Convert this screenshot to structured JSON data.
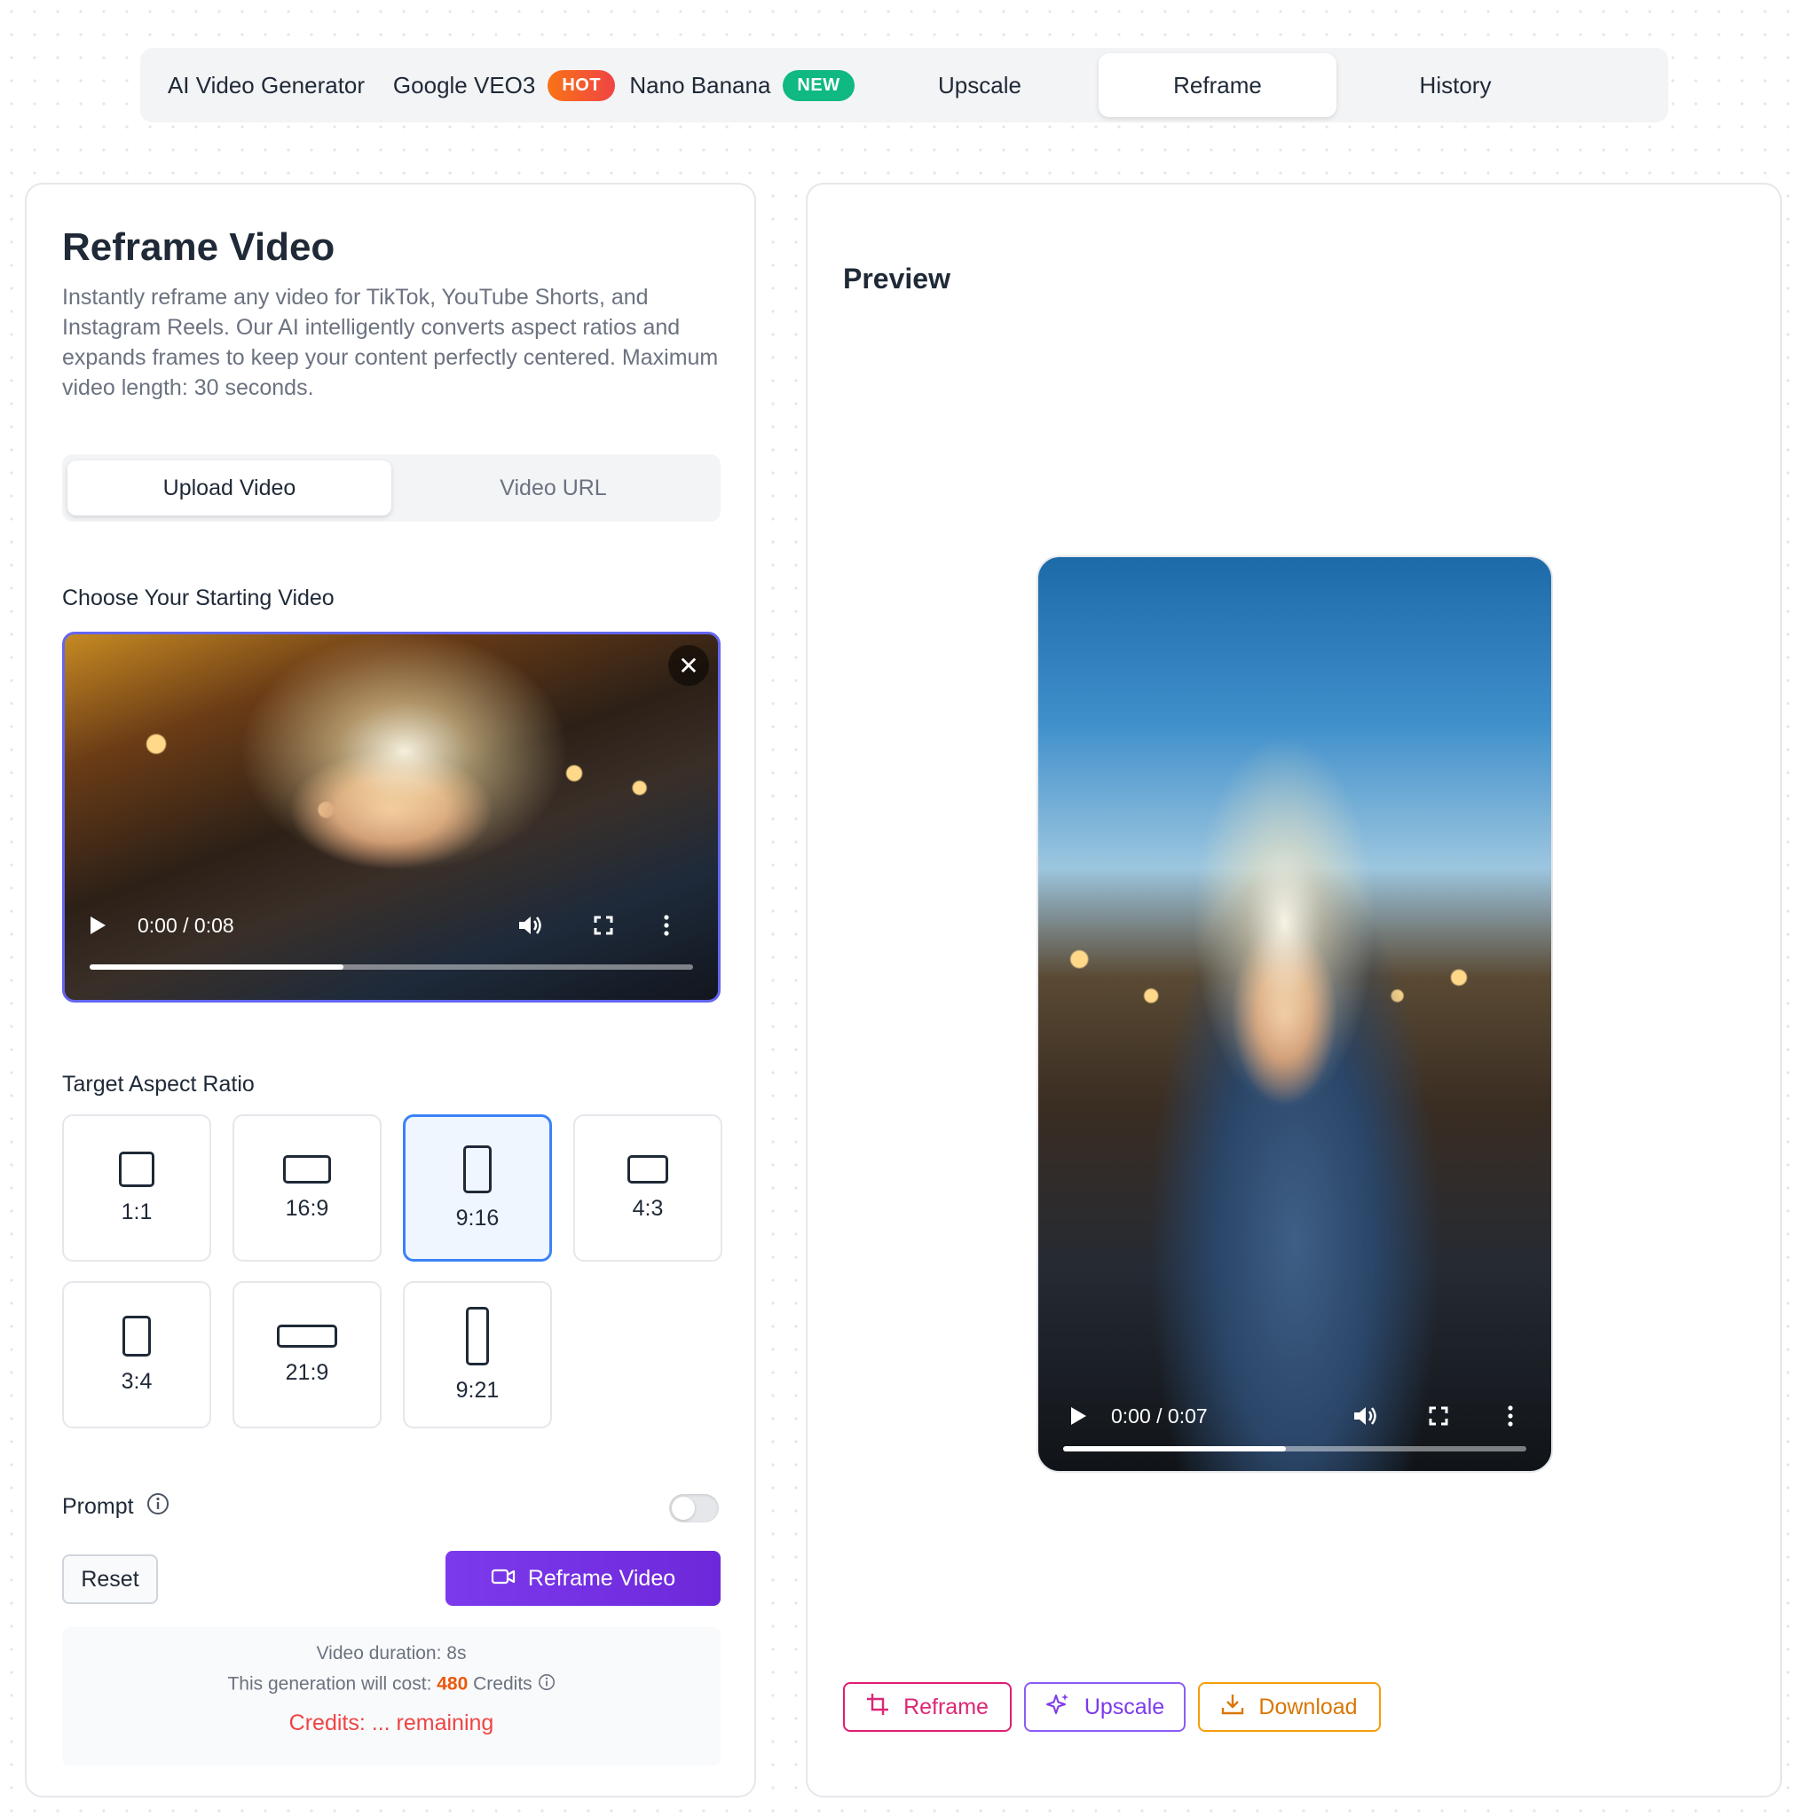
{
  "topnav": {
    "tabs": [
      {
        "label": "AI Video Generator"
      },
      {
        "label": "Google VEO3",
        "badge": "HOT"
      },
      {
        "label": "Nano Banana",
        "badge": "NEW"
      },
      {
        "label": "Upscale"
      },
      {
        "label": "Reframe",
        "active": true
      },
      {
        "label": "History"
      }
    ]
  },
  "left": {
    "title": "Reframe Video",
    "description": "Instantly reframe any video for TikTok, YouTube Shorts, and Instagram Reels. Our AI intelligently converts aspect ratios and expands frames to keep your content perfectly centered. Maximum video length: 30 seconds.",
    "source_tabs": [
      {
        "label": "Upload Video",
        "active": true
      },
      {
        "label": "Video URL"
      }
    ],
    "choose_label": "Choose Your Starting Video",
    "source_video": {
      "time": "0:00 / 0:08",
      "progress": 0.42
    },
    "ratio_label": "Target Aspect Ratio",
    "ratios": [
      {
        "label": "1:1"
      },
      {
        "label": "16:9"
      },
      {
        "label": "9:16",
        "active": true
      },
      {
        "label": "4:3"
      },
      {
        "label": "3:4"
      },
      {
        "label": "21:9"
      },
      {
        "label": "9:21"
      }
    ],
    "prompt_label": "Prompt",
    "prompt_enabled": false,
    "reset_label": "Reset",
    "submit_label": "Reframe Video",
    "cost": {
      "duration": "Video duration: 8s",
      "prefix": "This generation will cost:",
      "amount": "480",
      "suffix": "Credits",
      "remaining": "Credits: ... remaining"
    }
  },
  "right": {
    "title": "Preview",
    "video": {
      "time": "0:00 / 0:07",
      "progress": 0.48
    },
    "actions": {
      "reframe": "Reframe",
      "upscale": "Upscale",
      "download": "Download"
    }
  },
  "colors": {
    "accent": "#6d28d9",
    "selected_border": "#3b82f6",
    "hot_badge": "#f97316",
    "new_badge": "#10b981",
    "cost_amount": "#ea580c",
    "credits_text": "#ef4444"
  }
}
